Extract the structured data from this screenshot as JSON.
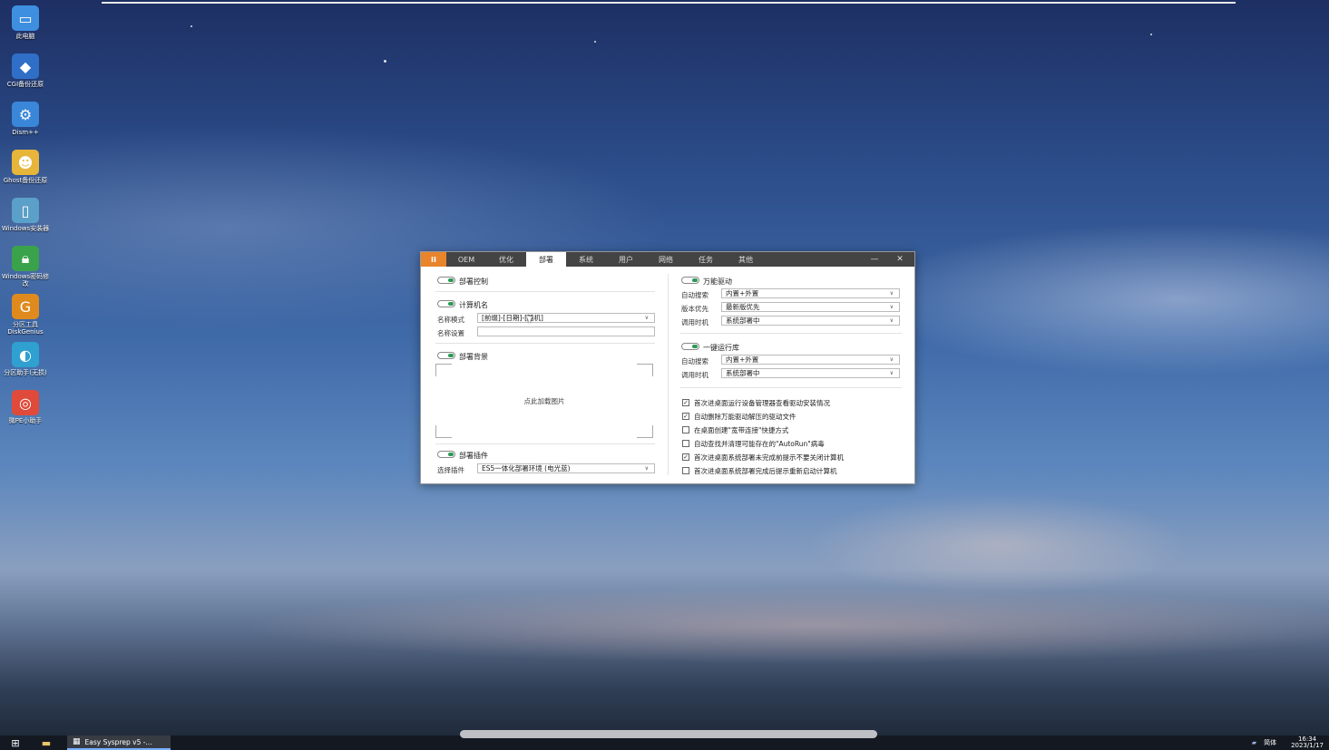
{
  "desktop": {
    "icons": [
      {
        "label": "此电脑",
        "icon": "computer-icon",
        "color": "#3f8fe0"
      },
      {
        "label": "CGI备份还原",
        "icon": "cgi-backup-icon",
        "color": "#2f6fc8"
      },
      {
        "label": "Dism++",
        "icon": "gears-icon",
        "color": "#3a86d8"
      },
      {
        "label": "Ghost备份还原",
        "icon": "ghost-icon",
        "color": "#e6b53a"
      },
      {
        "label": "Windows安装器",
        "icon": "windows-installer-icon",
        "color": "#5ba0c8"
      },
      {
        "label": "Windows密码修改",
        "icon": "lock-icon",
        "color": "#3aa24a"
      },
      {
        "label": "分区工具DiskGenius",
        "icon": "diskgenius-icon",
        "color": "#e08a1e"
      },
      {
        "label": "分区助手(无损)",
        "icon": "partition-assistant-icon",
        "color": "#2fa0d0"
      },
      {
        "label": "微PE小助手",
        "icon": "lifebuoy-icon",
        "color": "#e04a3a"
      }
    ]
  },
  "window": {
    "logo": "II",
    "tabs": [
      "OEM",
      "优化",
      "部署",
      "系统",
      "用户",
      "网络",
      "任务",
      "其他"
    ],
    "active_tab": "部署",
    "minimize": "—",
    "close": "✕"
  },
  "left": {
    "deploy_control": "部署控制",
    "computer_name": {
      "title": "计算机名",
      "mode_label": "名称模式",
      "mode_value": "[前缀]-[日期]-[随机]",
      "setting_label": "名称设置",
      "setting_value": ""
    },
    "background": {
      "title": "部署背景",
      "click_text": "点此加载图片"
    },
    "plugin": {
      "title": "部署插件",
      "select_label": "选择插件",
      "select_value": "ES5一体化部署环境 (电光蓝)"
    }
  },
  "right": {
    "universal_driver": {
      "title": "万能驱动",
      "rows": [
        {
          "label": "自动搜索",
          "value": "内置+外置"
        },
        {
          "label": "版本优先",
          "value": "最新版优先"
        },
        {
          "label": "调用时机",
          "value": "系统部署中"
        }
      ]
    },
    "runtime": {
      "title": "一键运行库",
      "rows": [
        {
          "label": "自动搜索",
          "value": "内置+外置"
        },
        {
          "label": "调用时机",
          "value": "系统部署中"
        }
      ]
    },
    "checkboxes": [
      {
        "label": "首次进桌面运行设备管理器查看驱动安装情况",
        "checked": true
      },
      {
        "label": "自动删除万能驱动解压的驱动文件",
        "checked": true
      },
      {
        "label": "在桌面创建\"宽带连接\"快捷方式",
        "checked": false
      },
      {
        "label": "自动查找并清理可能存在的\"AutoRun\"病毒",
        "checked": false
      },
      {
        "label": "首次进桌面系统部署未完成前提示不要关闭计算机",
        "checked": true
      },
      {
        "label": "首次进桌面系统部署完成后提示重新启动计算机",
        "checked": false
      }
    ]
  },
  "taskbar": {
    "start": "⊞",
    "folder": "▬",
    "task_label": "Easy Sysprep v5 -...",
    "task_icon": "▦",
    "lang": "简体",
    "time": "16:34",
    "date": "2023/1/17"
  }
}
